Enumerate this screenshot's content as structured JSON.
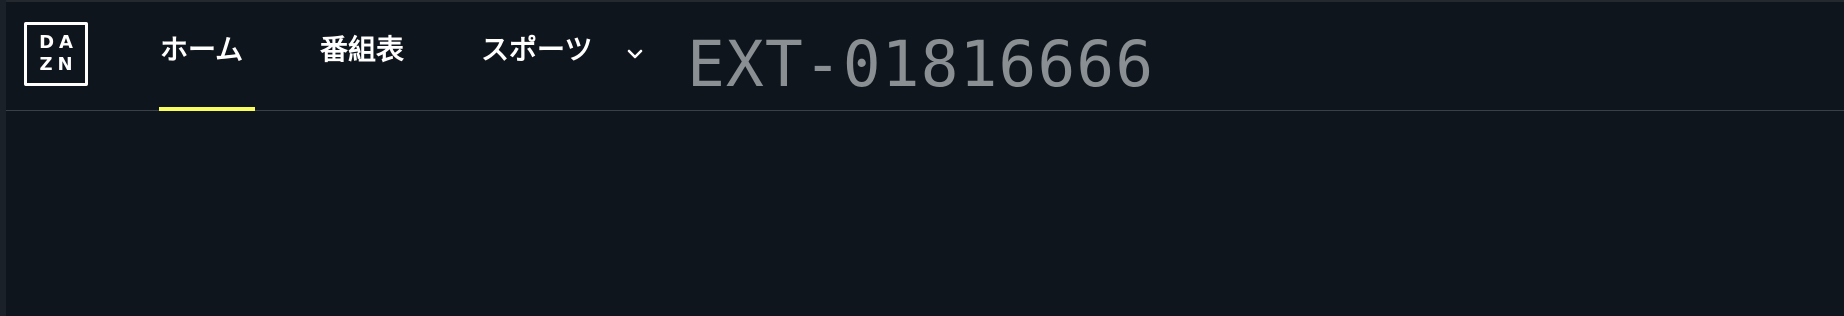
{
  "logo": {
    "line1": "DA",
    "line2": "ZN"
  },
  "nav": {
    "items": [
      {
        "label": "ホーム",
        "active": true
      },
      {
        "label": "番組表",
        "active": false
      },
      {
        "label": "スポーツ",
        "active": false
      }
    ]
  },
  "overlay": {
    "code": "EXT-01816666"
  },
  "colors": {
    "background": "#0f151c",
    "active_underline": "#f8fc5e",
    "nav_text": "#ffffff",
    "code_text": "#8a8f94"
  },
  "icons": {
    "dropdown": "chevron-down-icon"
  }
}
